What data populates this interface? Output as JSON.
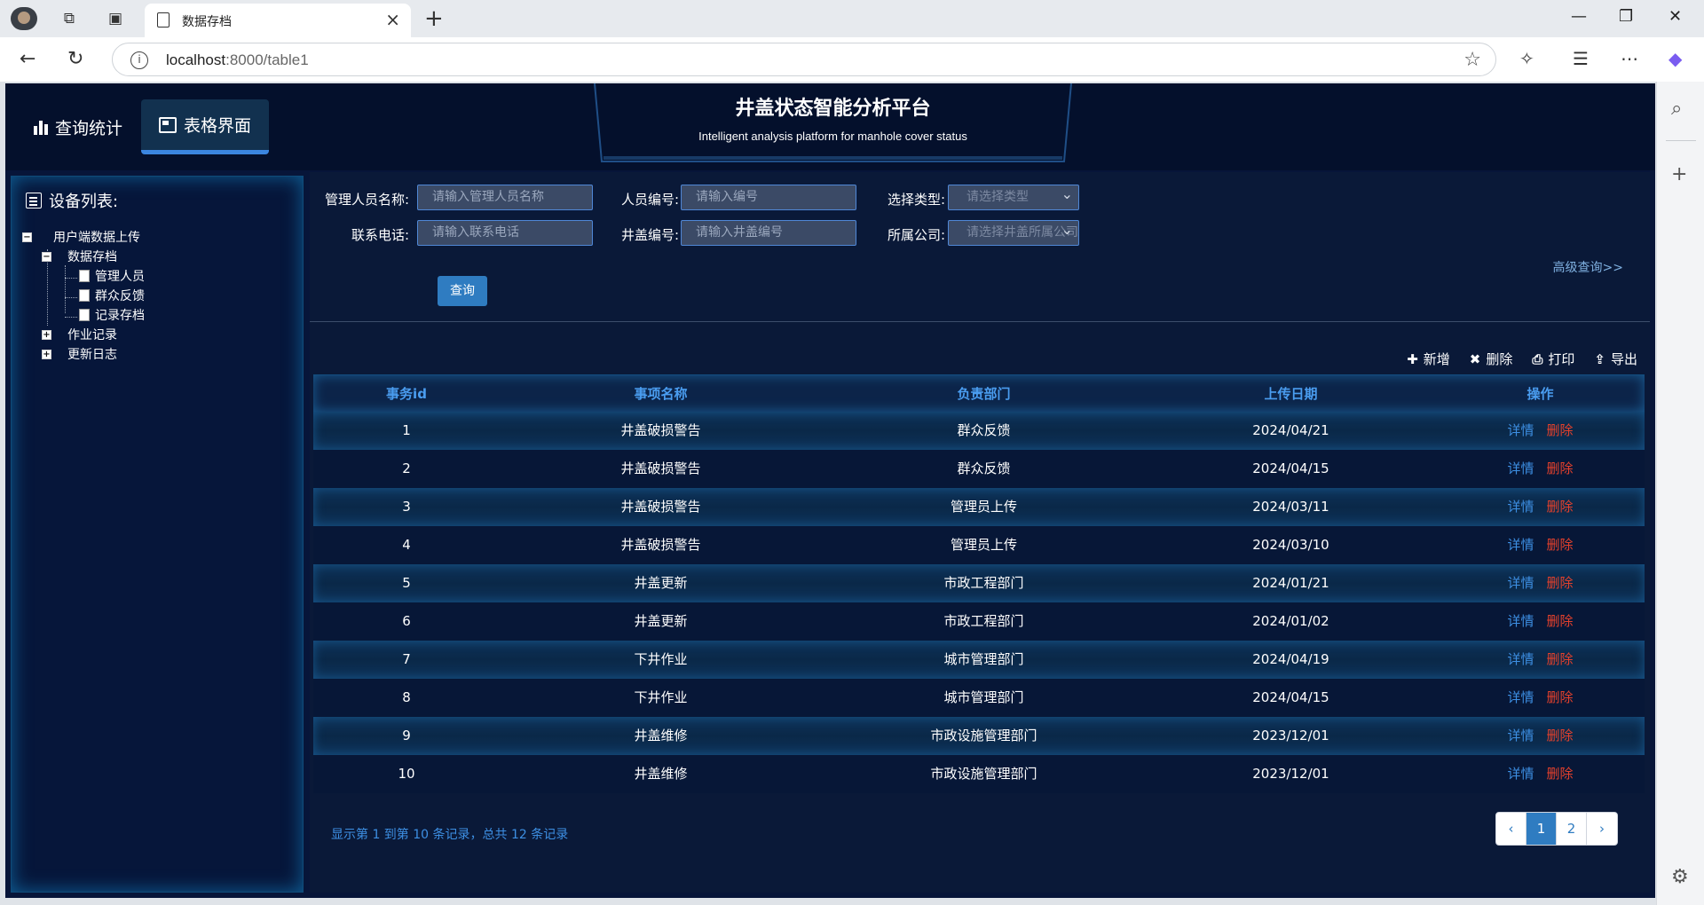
{
  "browser": {
    "tab_title": "数据存档",
    "url_host": "localhost",
    "url_path": ":8000/table1"
  },
  "header": {
    "nav": [
      {
        "label": "查询统计",
        "active": false
      },
      {
        "label": "表格界面",
        "active": true
      }
    ],
    "title": "井盖状态智能分析平台",
    "subtitle": "Intelligent analysis platform for manhole cover status"
  },
  "sidebar": {
    "title": "设备列表:",
    "tree": {
      "root": "用户端数据上传",
      "archive": "数据存档",
      "archive_children": [
        "管理人员",
        "群众反馈",
        "记录存档"
      ],
      "work_log": "作业记录",
      "update_log": "更新日志"
    }
  },
  "search": {
    "manager_label": "管理人员名称:",
    "manager_placeholder": "请输入管理人员名称",
    "staff_no_label": "人员编号:",
    "staff_no_placeholder": "请输入编号",
    "type_label": "选择类型:",
    "type_placeholder": "请选择类型",
    "phone_label": "联系电话:",
    "phone_placeholder": "请输入联系电话",
    "cover_no_label": "井盖编号:",
    "cover_no_placeholder": "请输入井盖编号",
    "company_label": "所属公司:",
    "company_placeholder": "请选择井盖所属公司",
    "advanced_link": "高级查询>>",
    "query_button": "查询"
  },
  "toolbar": {
    "add": "新增",
    "delete": "删除",
    "print": "打印",
    "export": "导出"
  },
  "table": {
    "columns": [
      "事务id",
      "事项名称",
      "负责部门",
      "上传日期",
      "操作"
    ],
    "action_detail": "详情",
    "action_delete": "删除",
    "rows": [
      [
        "1",
        "井盖破损警告",
        "群众反馈",
        "2024/04/21"
      ],
      [
        "2",
        "井盖破损警告",
        "群众反馈",
        "2024/04/15"
      ],
      [
        "3",
        "井盖破损警告",
        "管理员上传",
        "2024/03/11"
      ],
      [
        "4",
        "井盖破损警告",
        "管理员上传",
        "2024/03/10"
      ],
      [
        "5",
        "井盖更新",
        "市政工程部门",
        "2024/01/21"
      ],
      [
        "6",
        "井盖更新",
        "市政工程部门",
        "2024/01/02"
      ],
      [
        "7",
        "下井作业",
        "城市管理部门",
        "2024/04/19"
      ],
      [
        "8",
        "下井作业",
        "城市管理部门",
        "2024/04/15"
      ],
      [
        "9",
        "井盖维修",
        "市政设施管理部门",
        "2023/12/01"
      ],
      [
        "10",
        "井盖维修",
        "市政设施管理部门",
        "2023/12/01"
      ]
    ]
  },
  "pagination": {
    "info": "显示第 1 到第 10 条记录，总共 12 条记录",
    "prev": "‹",
    "pages": [
      "1",
      "2"
    ],
    "next": "›",
    "current": "1"
  },
  "colors": {
    "page_bg": "#071539",
    "accent_blue": "#3d8fe3",
    "delete_red": "#e5412c",
    "primary_button": "#2f7cc1"
  }
}
